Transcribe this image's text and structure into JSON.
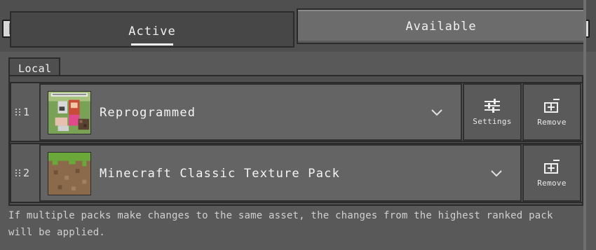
{
  "tabs": {
    "active_label": "Active",
    "available_label": "Available"
  },
  "section": {
    "label": "Local"
  },
  "packs": [
    {
      "rank": "1",
      "name": "Reprogrammed",
      "settings_label": "Settings",
      "remove_label": "Remove"
    },
    {
      "rank": "2",
      "name": "Minecraft Classic Texture Pack",
      "remove_label": "Remove"
    }
  ],
  "footer": {
    "note": "If multiple packs make changes to the same asset, the changes from the highest ranked pack will be applied."
  },
  "colors": {
    "background": "#595959",
    "panel": "#4f4f4f",
    "border": "#2b2b2b",
    "text": "#f0f0f0"
  },
  "icons": [
    "handle-icon",
    "grip-icon",
    "chevron-down-icon",
    "sliders-icon",
    "remove-icon"
  ]
}
